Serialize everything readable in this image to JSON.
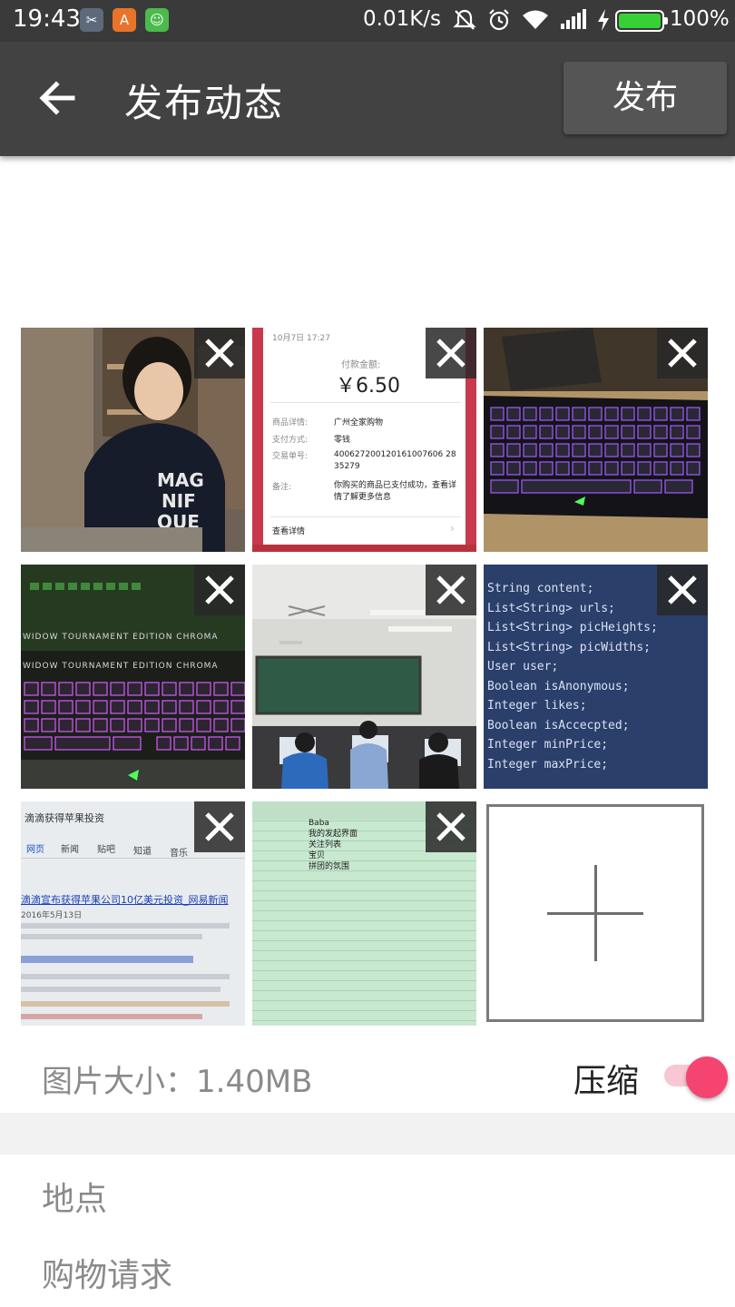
{
  "status_bar": {
    "time": "19:43",
    "network_speed": "0.01K/s",
    "battery_percent": "100%",
    "battery_level": 1.0,
    "icons": [
      "screenshot-app-icon",
      "shield-app-icon",
      "android-app-icon",
      "mute-icon",
      "alarm-icon",
      "wifi-icon",
      "signal-icon",
      "charging-icon",
      "battery-icon"
    ]
  },
  "toolbar": {
    "title": "发布动态",
    "publish_label": "发布",
    "back_icon": "arrow-left-icon"
  },
  "content": {
    "value": "",
    "placeholder": ""
  },
  "photos": [
    {
      "subject": "girl-portrait"
    },
    {
      "subject": "payment-receipt",
      "receipt": {
        "datetime": "10月7日 17:27",
        "amount_label": "付款金额:",
        "amount": "￥6.50",
        "detail_label": "商品详情:",
        "detail_value": "广州全家购物",
        "method_label": "支付方式:",
        "method_value": "零钱",
        "txn_label": "交易单号:",
        "txn_value": "400627200120161007606 2835279",
        "note_label": "备注:",
        "note_value": "你购买的商品已支付成功，查看详情了解更多信息",
        "link": "查看详情"
      }
    },
    {
      "subject": "keyboard"
    },
    {
      "subject": "keyboard-box",
      "caption": "WIDOW TOURNAMENT EDITION CHROMA"
    },
    {
      "subject": "classroom"
    },
    {
      "subject": "code-screen",
      "lines": [
        "String content;",
        "List<String> urls;",
        "List<String> picHeights;",
        "List<String> picWidths;",
        "User user;",
        "Boolean isAnonymous;",
        "Integer likes;",
        "Boolean isAccecpted;",
        "Integer minPrice;",
        "Integer maxPrice;"
      ]
    },
    {
      "subject": "search-results",
      "heading": "滴滴获得苹果投资",
      "tabs": [
        "网页",
        "新闻",
        "贴吧",
        "知道",
        "音乐"
      ],
      "headline": "滴滴宣布获得苹果公司10亿美元投资_网易新闻",
      "date": "2016年5月13日"
    },
    {
      "subject": "spreadsheet",
      "lines": [
        "Baba",
        "我的发起界面",
        "关注列表",
        "宝贝",
        "拼团的氛围"
      ]
    }
  ],
  "add_photo_icon": "plus-icon",
  "image_size": {
    "label": "图片大小：1.40MB",
    "compress_label": "压缩",
    "compress_on": true
  },
  "options": {
    "location_label": "地点",
    "shopping_request_label": "购物请求"
  },
  "colors": {
    "toolbar_bg": "#424242",
    "status_bar_bg": "#3a3a3a",
    "accent_pink": "#f4446f",
    "publish_btn_bg": "#555555"
  }
}
